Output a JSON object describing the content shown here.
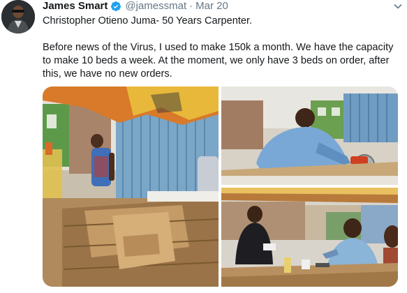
{
  "tweet": {
    "display_name": "James Smart",
    "handle": "@jamessmat",
    "separator": "·",
    "timestamp": "Mar 20",
    "title_line": "Christopher Otieno Juma- 50 Years Carpenter.",
    "body_line_1": "Before news of the Virus, I used to make 150k a month. We have the capacity",
    "body_line_2": "to make 10 beds a week. At the moment, we only have 3 beds on order, after",
    "body_line_3": "this, we have no new orders."
  },
  "icons": {
    "verified": "verified-badge-icon",
    "more": "chevron-down-icon"
  },
  "colors": {
    "verified_blue": "#1da1f2",
    "secondary_text": "#657786",
    "primary_text": "#14171a"
  }
}
